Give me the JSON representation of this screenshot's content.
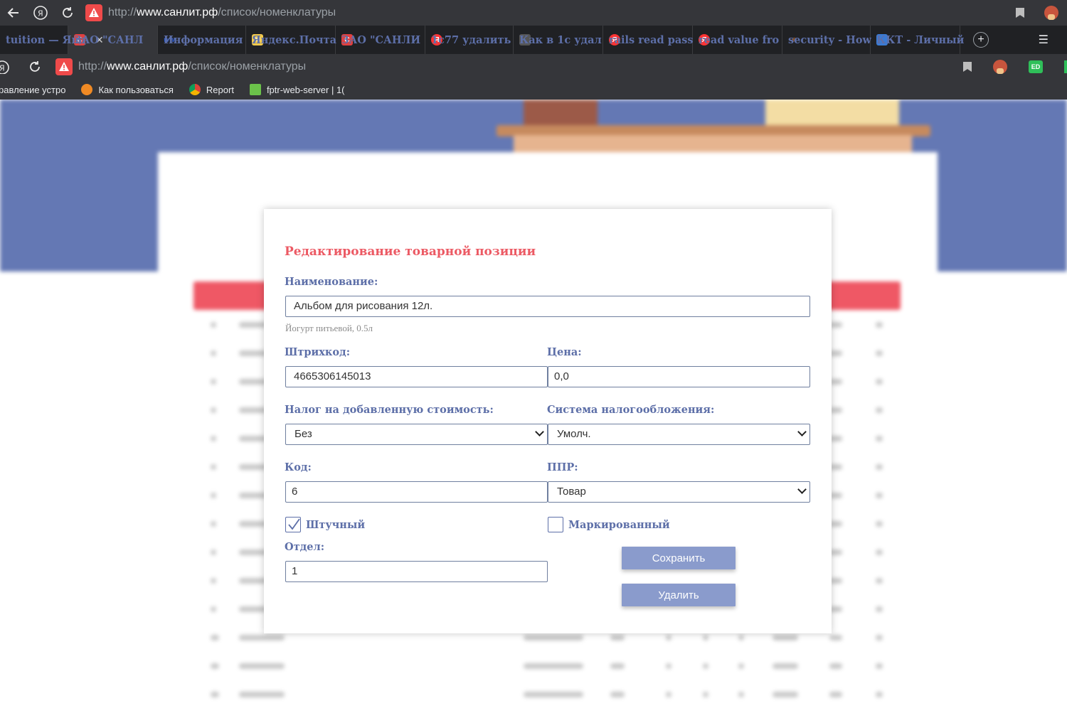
{
  "browser": {
    "url_prefix": "http://",
    "url_host": "www.санлит.рф",
    "url_path": "/список/номенклатуры",
    "tabs": [
      {
        "label": "tuition — Янд",
        "icon": "generic-icon",
        "color": "#202124"
      },
      {
        "label": "ЗАО \"САНЛ",
        "icon": "sanlit-icon",
        "color": "#e04040",
        "active": true
      },
      {
        "label": "Информация",
        "icon": "ww-icon",
        "color": "#2a5ad0"
      },
      {
        "label": "Яндекс.Почта",
        "icon": "mail-icon",
        "color": "#f2c94c"
      },
      {
        "label": "ЗАО \"САНЛИ",
        "icon": "sanlit-icon",
        "color": "#e04040"
      },
      {
        "label": "1с77 удалить",
        "icon": "yandex-icon",
        "color": "#f33"
      },
      {
        "label": "Как в 1с удал",
        "icon": "generic-icon",
        "color": "#555"
      },
      {
        "label": "rails read pass",
        "icon": "yandex-icon",
        "color": "#f33"
      },
      {
        "label": "read value fro",
        "icon": "yandex-icon",
        "color": "#f33"
      },
      {
        "label": "security - How",
        "icon": "stackoverflow-icon",
        "color": "#f48024"
      },
      {
        "label": "ККТ - Личный",
        "icon": "kkt-icon",
        "color": "#3a7bd5"
      }
    ],
    "bookmarks": [
      {
        "label": "равление устро",
        "icon": "generic-icon",
        "color": "#35363a"
      },
      {
        "label": "Как пользоваться",
        "icon": "lc-icon",
        "color": "#f08a24"
      },
      {
        "label": "Report",
        "icon": "chrome-icon",
        "color": "#4caf50"
      },
      {
        "label": "fptr-web-server | 1(",
        "icon": "fptr-icon",
        "color": "#6bc24a"
      }
    ]
  },
  "modal": {
    "title": "Редактирование товарной позиции",
    "name_label": "Наименование:",
    "name_value": "Альбом для рисования 12л.",
    "name_hint": "Йогурт питьевой, 0.5л",
    "barcode_label": "Штрихкод:",
    "barcode_value": "4665306145013",
    "price_label": "Цена:",
    "price_value": "0,0",
    "vat_label": "Налог на добавленную стоимость:",
    "vat_value": "Без",
    "taxsys_label": "Система налогообложения:",
    "taxsys_value": "Умолч.",
    "code_label": "Код:",
    "code_value": "6",
    "ppr_label": "ППР:",
    "ppr_value": "Товар",
    "piece_label": "Штучный",
    "piece_checked": true,
    "marked_label": "Маркированный",
    "marked_checked": false,
    "dept_label": "Отдел:",
    "dept_value": "1",
    "save_label": "Сохранить",
    "delete_label": "Удалить"
  },
  "colors": {
    "accent_title": "#ec5a64",
    "label": "#5d6fa8",
    "button": "#8a9bcc",
    "header_bg": "#6478b4"
  }
}
